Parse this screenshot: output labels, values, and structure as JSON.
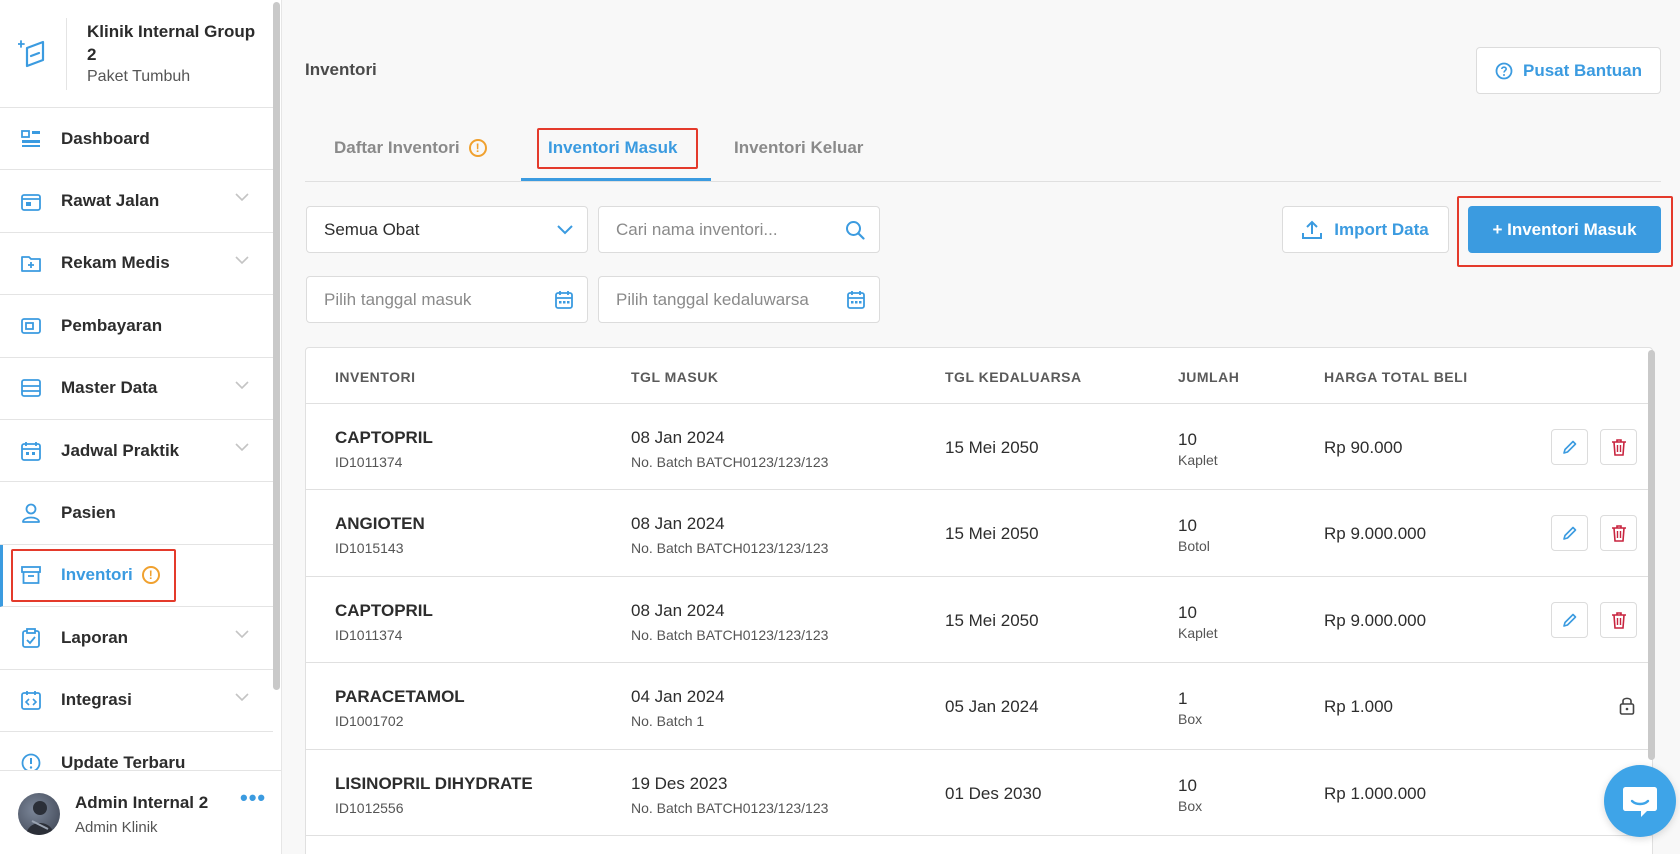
{
  "brand": {
    "name": "Klinik Internal Group 2",
    "plan": "Paket Tumbuh"
  },
  "sidebar": {
    "items": [
      {
        "label": "Dashboard",
        "icon": "dashboard-icon",
        "has_chevron": false
      },
      {
        "label": "Rawat Jalan",
        "icon": "outpatient-icon",
        "has_chevron": true
      },
      {
        "label": "Rekam Medis",
        "icon": "medical-record-icon",
        "has_chevron": true
      },
      {
        "label": "Pembayaran",
        "icon": "payment-icon",
        "has_chevron": false
      },
      {
        "label": "Master Data",
        "icon": "master-data-icon",
        "has_chevron": true
      },
      {
        "label": "Jadwal Praktik",
        "icon": "calendar-icon",
        "has_chevron": true
      },
      {
        "label": "Pasien",
        "icon": "person-icon",
        "has_chevron": false
      },
      {
        "label": "Inventori",
        "icon": "archive-icon",
        "has_chevron": false,
        "active": true,
        "badge": "!"
      },
      {
        "label": "Laporan",
        "icon": "clipboard-icon",
        "has_chevron": true
      },
      {
        "label": "Integrasi",
        "icon": "integration-icon",
        "has_chevron": true
      },
      {
        "label": "Update Terbaru",
        "icon": "info-icon",
        "has_chevron": false
      }
    ]
  },
  "user": {
    "name": "Admin Internal 2",
    "role": "Admin Klinik",
    "menu": "•••"
  },
  "header": {
    "title": "Inventori",
    "help_label": "Pusat Bantuan"
  },
  "tabs": [
    {
      "label": "Daftar Inventori",
      "badge": "!"
    },
    {
      "label": "Inventori Masuk",
      "active": true
    },
    {
      "label": "Inventori Keluar"
    }
  ],
  "filters": {
    "category": "Semua Obat",
    "search_placeholder": "Cari nama inventori...",
    "date_in_placeholder": "Pilih tanggal masuk",
    "date_exp_placeholder": "Pilih tanggal kedaluwarsa"
  },
  "actions": {
    "import_label": "Import Data",
    "add_label": "+ Inventori Masuk"
  },
  "table": {
    "columns": [
      "INVENTORI",
      "TGL MASUK",
      "TGL KEDALUARSA",
      "JUMLAH",
      "HARGA TOTAL BELI"
    ],
    "rows": [
      {
        "name": "CAPTOPRIL",
        "id": "ID1011374",
        "date_in": "08 Jan 2024",
        "batch": "No. Batch BATCH0123/123/123",
        "expiry": "15 Mei 2050",
        "qty": "10",
        "unit": "Kaplet",
        "price": "Rp 90.000",
        "locked": false
      },
      {
        "name": "ANGIOTEN",
        "id": "ID1015143",
        "date_in": "08 Jan 2024",
        "batch": "No. Batch BATCH0123/123/123",
        "expiry": "15 Mei 2050",
        "qty": "10",
        "unit": "Botol",
        "price": "Rp 9.000.000",
        "locked": false
      },
      {
        "name": "CAPTOPRIL",
        "id": "ID1011374",
        "date_in": "08 Jan 2024",
        "batch": "No. Batch BATCH0123/123/123",
        "expiry": "15 Mei 2050",
        "qty": "10",
        "unit": "Kaplet",
        "price": "Rp 9.000.000",
        "locked": false
      },
      {
        "name": "PARACETAMOL",
        "id": "ID1001702",
        "date_in": "04 Jan 2024",
        "batch": "No. Batch 1",
        "expiry": "05 Jan 2024",
        "qty": "1",
        "unit": "Box",
        "price": "Rp 1.000",
        "locked": true
      },
      {
        "name": "LISINOPRIL DIHYDRATE",
        "id": "ID1012556",
        "date_in": "19 Des 2023",
        "batch": "No. Batch BATCH0123/123/123",
        "expiry": "01 Des 2030",
        "qty": "10",
        "unit": "Box",
        "price": "Rp 1.000.000",
        "locked": null
      }
    ]
  },
  "colors": {
    "accent": "#3b9be0",
    "warning": "#f0a12f",
    "danger": "#c8243f",
    "highlight": "#e43a2b"
  }
}
